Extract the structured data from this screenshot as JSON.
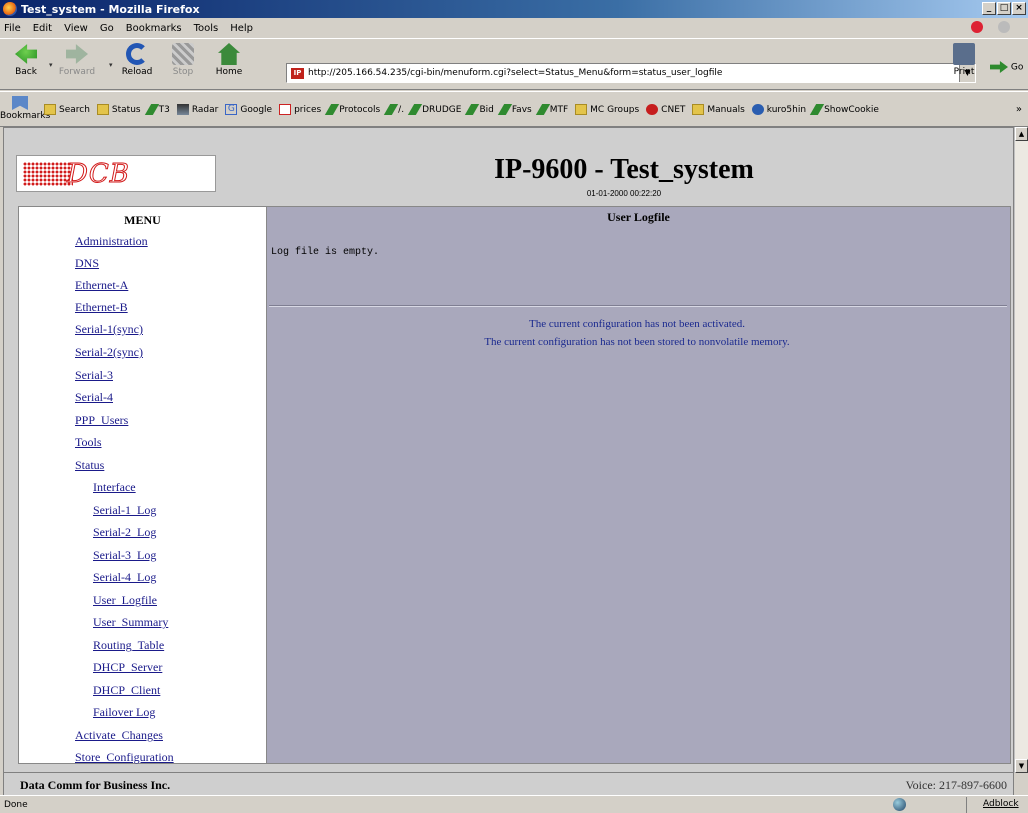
{
  "window": {
    "title": "Test_system - Mozilla Firefox",
    "controls": [
      "_",
      "□",
      "×"
    ]
  },
  "menubar": {
    "items": [
      "File",
      "Edit",
      "View",
      "Go",
      "Bookmarks",
      "Tools",
      "Help"
    ]
  },
  "navbar": {
    "back": "Back",
    "forward": "Forward",
    "reload": "Reload",
    "stop": "Stop",
    "home": "Home",
    "print": "Print",
    "go": "Go",
    "url": "http://205.166.54.235/cgi-bin/menuform.cgi?select=Status_Menu&form=status_user_logfile",
    "site_icon_text": "IP"
  },
  "bookmarks": {
    "toolbar_label": "Bookmarks",
    "items": [
      {
        "label": "Search",
        "icon": "folder-icon"
      },
      {
        "label": "Status",
        "icon": "folder-icon"
      },
      {
        "label": "T3",
        "icon": "bookmark-icon"
      },
      {
        "label": "Radar",
        "icon": "radar-icon"
      },
      {
        "label": "Google",
        "icon": "google-icon"
      },
      {
        "label": "prices",
        "icon": "pdf-icon"
      },
      {
        "label": "Protocols",
        "icon": "bookmark-icon"
      },
      {
        "label": "/.",
        "icon": "slashdot-icon"
      },
      {
        "label": "DRUDGE",
        "icon": "bookmark-icon"
      },
      {
        "label": "Bid",
        "icon": "bookmark-icon"
      },
      {
        "label": "Favs",
        "icon": "bookmark-icon"
      },
      {
        "label": "MTF",
        "icon": "bookmark-icon"
      },
      {
        "label": "MC Groups",
        "icon": "folder-icon"
      },
      {
        "label": "CNET",
        "icon": "cnet-icon"
      },
      {
        "label": "Manuals",
        "icon": "folder-icon"
      },
      {
        "label": "kuro5hin",
        "icon": "kuro5hin-icon"
      },
      {
        "label": "ShowCookie",
        "icon": "bookmark-icon"
      }
    ],
    "more": "»"
  },
  "page": {
    "logo_text": "DCB",
    "title": "IP-9600 - Test_system",
    "datetime": "01-01-2000 00:22:20",
    "menu_title": "MENU",
    "menu_items": [
      "Administration",
      "DNS",
      "Ethernet-A",
      "Ethernet-B",
      "Serial-1(sync)",
      "Serial-2(sync)",
      "Serial-3",
      "Serial-4",
      "PPP_Users",
      "Tools",
      "Status"
    ],
    "status_subitems": [
      "Interface",
      "Serial-1_Log",
      "Serial-2_Log",
      "Serial-3_Log",
      "Serial-4_Log",
      "User_Logfile",
      "User_Summary",
      "Routing_Table",
      "DHCP_Server",
      "DHCP_Client",
      "Failover Log"
    ],
    "bottom_items": [
      "Activate_Changes",
      "Store_Configuration"
    ],
    "main_title": "User Logfile",
    "log_message": "Log file is empty.",
    "warning_1": "The current configuration has not been activated.",
    "warning_2": "The current configuration has not been stored to nonvolatile memory.",
    "footer_left": "Data Comm for Business Inc.",
    "footer_right": "Voice: 217-897-6600"
  },
  "statusbar": {
    "text": "Done",
    "adblock": "Adblock"
  }
}
